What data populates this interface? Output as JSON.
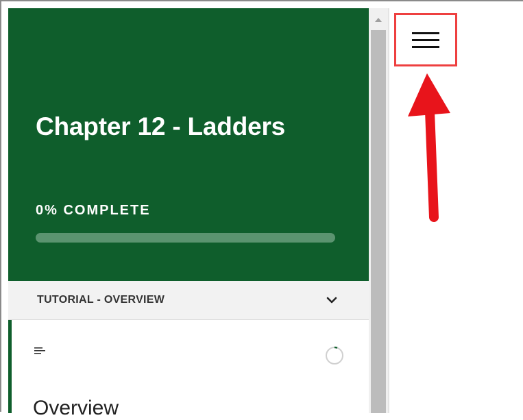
{
  "sidebar": {
    "course_title": "Chapter 12 - Ladders",
    "progress": {
      "label": "0% COMPLETE",
      "percent": 0
    },
    "section": {
      "title": "TUTORIAL - OVERVIEW",
      "expanded": true
    },
    "lesson": {
      "title": "Overview",
      "type_icon": "text-lines-icon",
      "status_icon": "loading-circle-icon"
    }
  },
  "toolbar": {
    "menu_icon": "hamburger-menu-icon"
  },
  "colors": {
    "brand_green": "#0f5e2c",
    "progress_track": "#5b9470",
    "highlight_red": "#ee4040",
    "arrow_red": "#e8141b"
  }
}
